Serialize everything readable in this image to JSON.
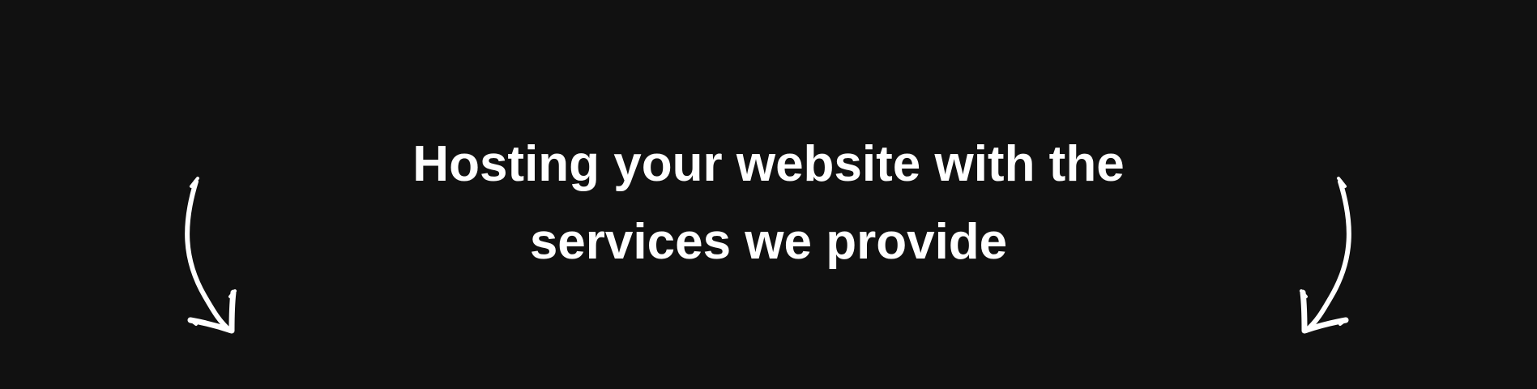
{
  "hero": {
    "headline_line_1": "Hosting your website with the",
    "headline_line_2": "services we provide",
    "background_color": "#111111",
    "text_color": "#ffffff"
  },
  "decor": {
    "left_icon": "curved-down-arrow-left",
    "right_icon": "curved-down-arrow-right"
  }
}
